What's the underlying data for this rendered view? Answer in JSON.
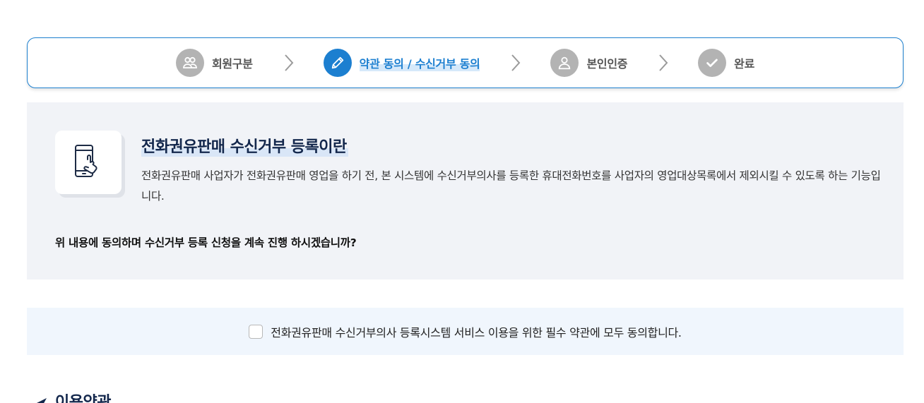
{
  "stepper": {
    "steps": [
      {
        "label": "회원구분",
        "icon": "users-icon",
        "active": false
      },
      {
        "label": "약관 동의 / 수신거부 동의",
        "icon": "pencil-icon",
        "active": true
      },
      {
        "label": "본인인증",
        "icon": "user-icon",
        "active": false
      },
      {
        "label": "완료",
        "icon": "check-icon",
        "active": false
      }
    ]
  },
  "info": {
    "title": "전화권유판매 수신거부 등록이란",
    "description": "전화권유판매 사업자가 전화권유판매 영업을 하기 전, 본 시스템에 수신거부의사를 등록한 휴대전화번호를 사업자의 영업대상목록에서 제외시킬 수 있도록 하는 기능입니다.",
    "question": "위 내용에 동의하며 수신거부 등록 신청을 계속 진행 하시겠습니까?",
    "icon": "phone-touch-icon"
  },
  "agree": {
    "label": "전화권유판매 수신거부의사 등록시스템 서비스 이용을 위한 필수 약관에 모두 동의합니다.",
    "checked": false
  },
  "terms": {
    "heading": "이용약관"
  },
  "colors": {
    "accent": "#1c7fd0",
    "inactive_step": "#b3b3b3",
    "navy": "#13274c",
    "info_bg": "#f1f3f7",
    "agree_bg": "#f0f6fd"
  }
}
